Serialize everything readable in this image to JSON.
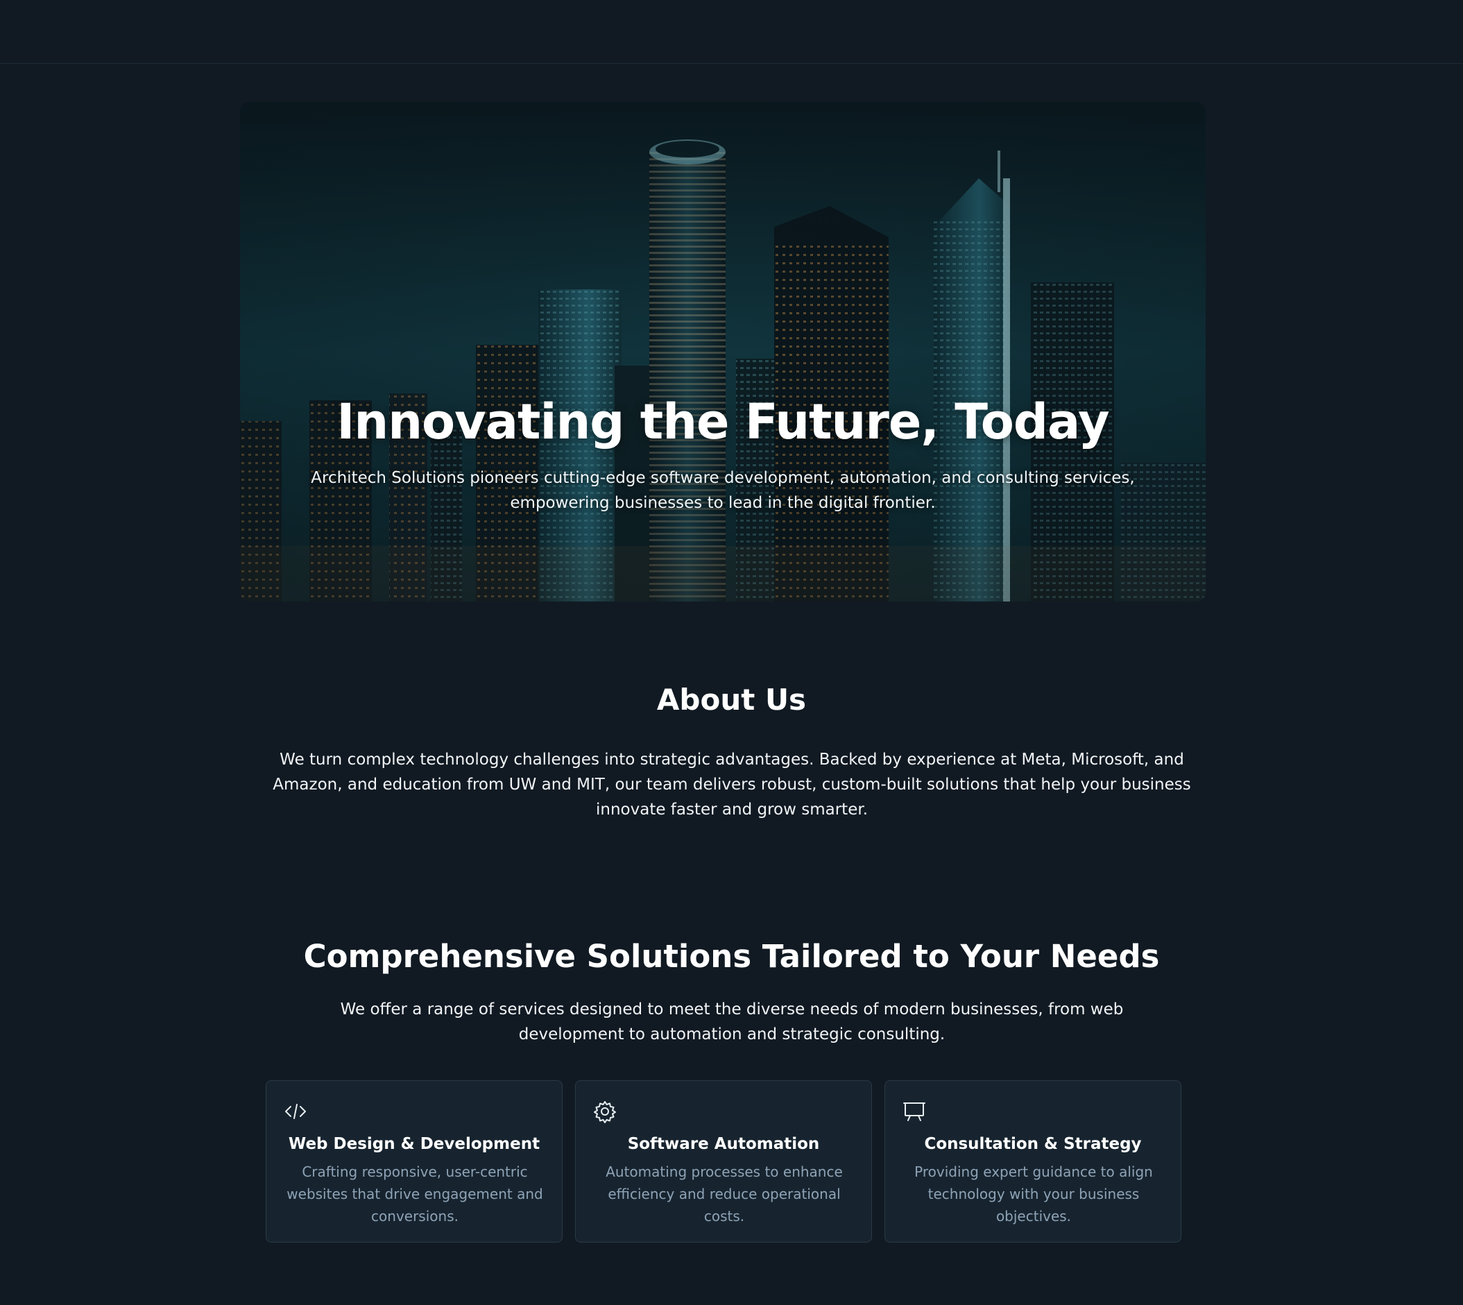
{
  "hero": {
    "title": "Innovating the Future, Today",
    "subtitle": "Architech Solutions pioneers cutting-edge software development, automation, and consulting services, empowering businesses to lead in the digital frontier."
  },
  "about": {
    "title": "About Us",
    "text": "We turn complex technology challenges into strategic advantages. Backed by experience at Meta, Microsoft, and Amazon, and education from UW and MIT, our team delivers robust, custom-built solutions that help your business innovate faster and grow smarter."
  },
  "services": {
    "title": "Comprehensive Solutions Tailored to Your Needs",
    "text": "We offer a range of services designed to meet the diverse needs of modern businesses, from web development to automation and strategic consulting.",
    "cards": [
      {
        "icon": "code-icon",
        "title": "Web Design & Development",
        "description": "Crafting responsive, user-centric websites that drive engagement and conversions."
      },
      {
        "icon": "gear-icon",
        "title": "Software Automation",
        "description": "Automating processes to enhance efficiency and reduce operational costs."
      },
      {
        "icon": "presentation-icon",
        "title": "Consultation & Strategy",
        "description": "Providing expert guidance to align technology with your business objectives."
      }
    ]
  },
  "colors": {
    "background": "#111a23",
    "card_background": "#17242f",
    "card_border": "#2a3a47",
    "muted_text": "#8ea3b6"
  }
}
